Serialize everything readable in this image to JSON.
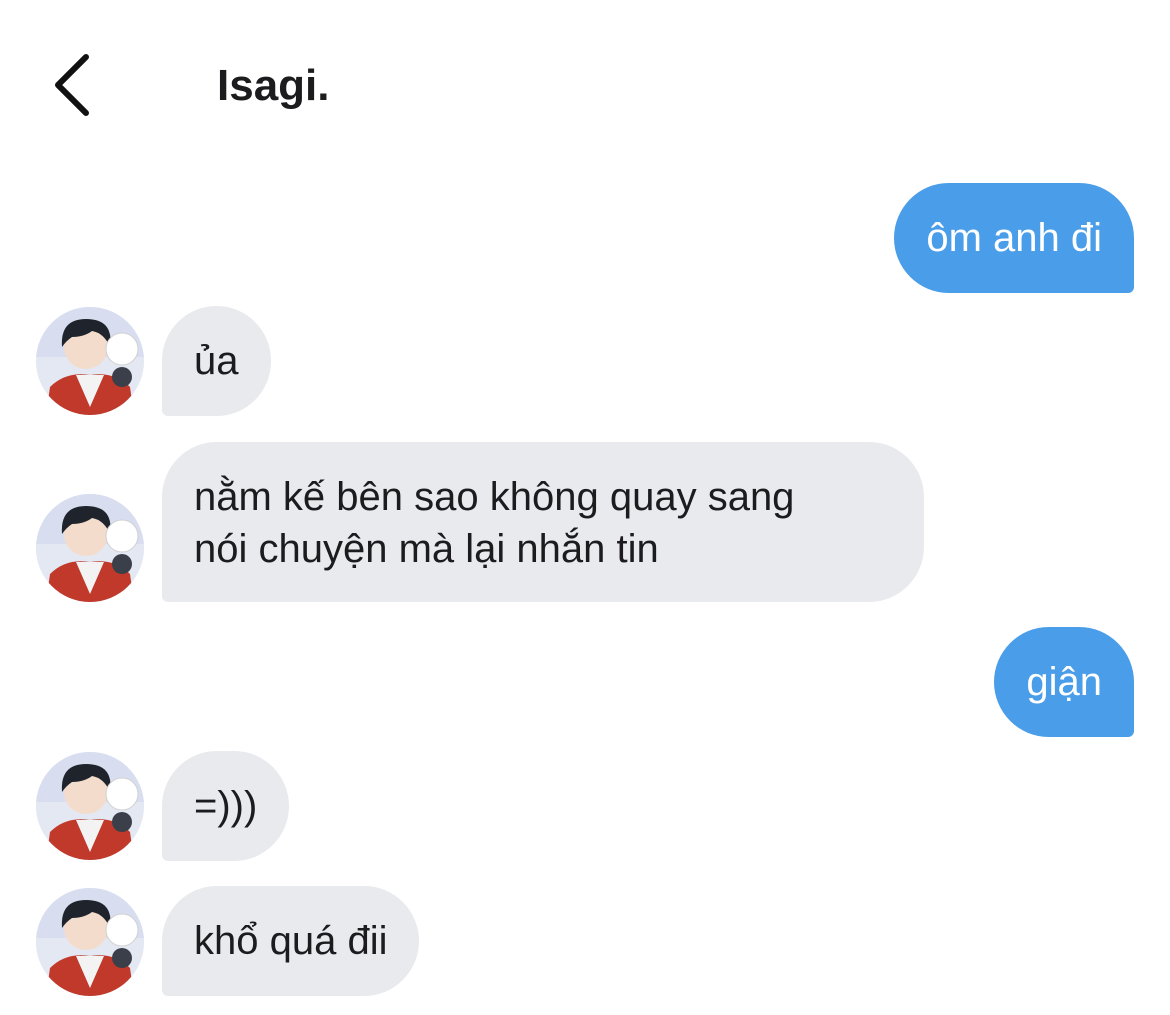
{
  "header": {
    "back_icon": "chevron-left-icon",
    "title": "Isagi."
  },
  "colors": {
    "outgoing_bubble": "#4a9de8",
    "incoming_bubble": "#e8eaee",
    "background": "#ffffff"
  },
  "messages": [
    {
      "direction": "outgoing",
      "text": "ôm anh đi"
    },
    {
      "direction": "incoming",
      "text": "ủa"
    },
    {
      "direction": "incoming",
      "lines": [
        "nằm kế bên sao không quay sang",
        "nói chuyện mà lại nhắn tin"
      ]
    },
    {
      "direction": "outgoing",
      "text": "giận"
    },
    {
      "direction": "incoming",
      "text": "=)))"
    },
    {
      "direction": "incoming",
      "text": "khổ quá đii"
    }
  ]
}
